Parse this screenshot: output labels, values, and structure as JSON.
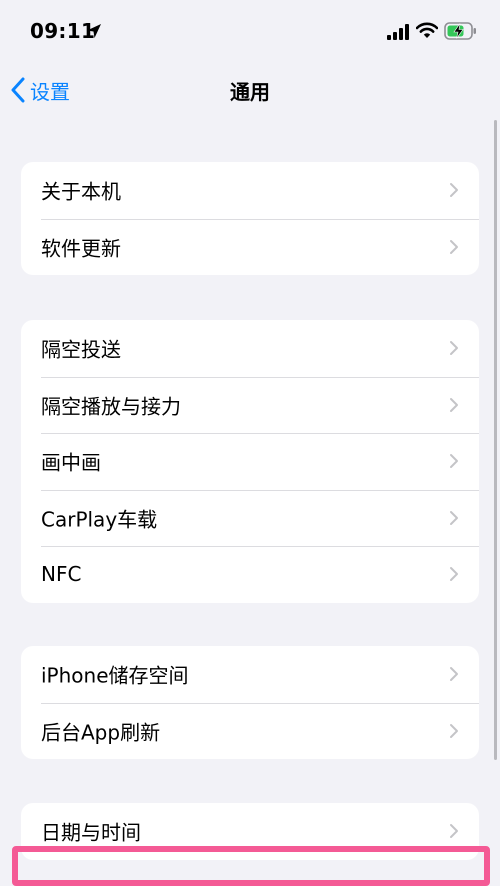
{
  "status_bar": {
    "time": "09:11",
    "icons": [
      "location-arrow-icon",
      "cellular-signal-icon",
      "wifi-icon",
      "battery-charging-icon"
    ],
    "battery_color": "#34c759"
  },
  "nav": {
    "back_label": "设置",
    "title": "通用",
    "accent_color": "#0a84ff"
  },
  "groups": [
    {
      "items": [
        {
          "label": "关于本机"
        },
        {
          "label": "软件更新"
        }
      ]
    },
    {
      "items": [
        {
          "label": "隔空投送"
        },
        {
          "label": "隔空播放与接力"
        },
        {
          "label": "画中画"
        },
        {
          "label": "CarPlay车载"
        },
        {
          "label": "NFC"
        }
      ]
    },
    {
      "items": [
        {
          "label": "iPhone储存空间"
        },
        {
          "label": "后台App刷新"
        }
      ]
    },
    {
      "items": [
        {
          "label": "日期与时间"
        }
      ]
    }
  ],
  "highlight_color": "#f45a95"
}
